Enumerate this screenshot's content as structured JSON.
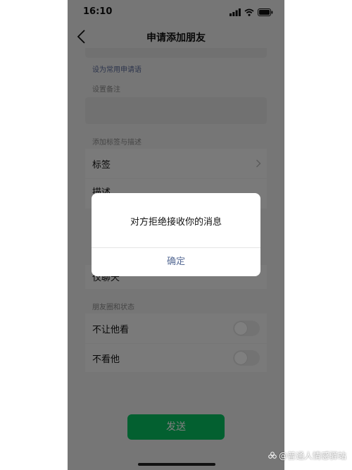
{
  "status_bar": {
    "time": "16:10",
    "icons": [
      "signal-icon",
      "wifi-icon",
      "battery-icon"
    ]
  },
  "nav": {
    "title": "申请添加朋友",
    "back_icon": "chevron-left-icon"
  },
  "form": {
    "set_common_phrase": "设为常用申请语",
    "remark_label": "设置备注",
    "tags_section_label": "添加标签与描述",
    "tags_row": "标签",
    "description_row": "描述",
    "partial_row": "仅聊天",
    "moments_section_label": "朋友圈和状态",
    "toggles": [
      {
        "label": "不让他看",
        "on": false
      },
      {
        "label": "不看他",
        "on": false
      }
    ],
    "send_button": "发送"
  },
  "dialog": {
    "message": "对方拒绝接收你的消息",
    "confirm": "确定"
  },
  "watermark": "@普通人情感驿站",
  "colors": {
    "send_green": "#07c160",
    "link_blue": "#576b95",
    "background": "#ededed"
  }
}
